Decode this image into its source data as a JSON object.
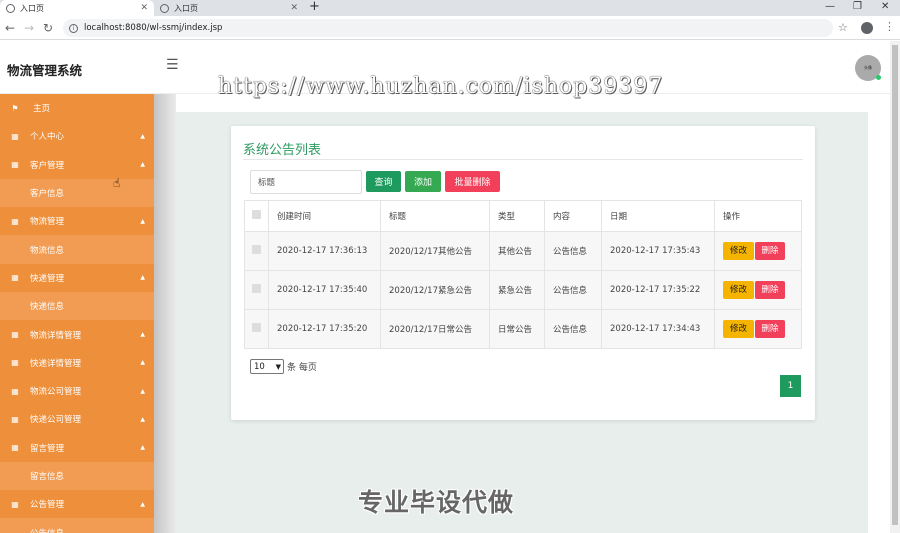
{
  "browser": {
    "tabs": [
      {
        "label": "入口页",
        "active": true
      },
      {
        "label": "入口页",
        "active": false
      }
    ],
    "url": "localhost:8080/wl-ssmj/index.jsp"
  },
  "header": {
    "brand": "物流管理系统",
    "avatar_text": "头像",
    "watermark": "https://www.huzhan.com/ishop39397"
  },
  "sidebar": {
    "items": [
      {
        "label": "主页",
        "type": "group",
        "icon": "flag-icon"
      },
      {
        "label": "个人中心",
        "type": "group",
        "icon": "grid-icon",
        "arrow": true
      },
      {
        "label": "客户管理",
        "type": "group",
        "icon": "grid-icon",
        "arrow": true
      },
      {
        "label": "客户信息",
        "type": "sub"
      },
      {
        "label": "物流管理",
        "type": "group",
        "icon": "grid-icon",
        "arrow": true
      },
      {
        "label": "物流信息",
        "type": "sub"
      },
      {
        "label": "快递管理",
        "type": "group",
        "icon": "grid-icon",
        "arrow": true
      },
      {
        "label": "快递信息",
        "type": "sub"
      },
      {
        "label": "物流详情管理",
        "type": "group",
        "icon": "grid-icon",
        "arrow": true
      },
      {
        "label": "快递详情管理",
        "type": "group",
        "icon": "grid-icon",
        "arrow": true
      },
      {
        "label": "物流公司管理",
        "type": "group",
        "icon": "grid-icon",
        "arrow": true
      },
      {
        "label": "快递公司管理",
        "type": "group",
        "icon": "grid-icon",
        "arrow": true
      },
      {
        "label": "留言管理",
        "type": "group",
        "icon": "grid-icon",
        "arrow": true
      },
      {
        "label": "留言信息",
        "type": "sub"
      },
      {
        "label": "公告管理",
        "type": "group",
        "icon": "grid-icon",
        "arrow": true
      },
      {
        "label": "公告信息",
        "type": "sub"
      }
    ]
  },
  "main": {
    "title": "系统公告列表",
    "search_placeholder": "标题",
    "buttons": {
      "query": "查询",
      "add": "添加",
      "batch_delete": "批量删除"
    },
    "columns": [
      "创建时间",
      "标题",
      "类型",
      "内容",
      "日期",
      "操作"
    ],
    "rows": [
      {
        "created": "2020-12-17 17:36:13",
        "title": "2020/12/17其他公告",
        "type": "其他公告",
        "content": "公告信息",
        "date": "2020-12-17 17:35:43"
      },
      {
        "created": "2020-12-17 17:35:40",
        "title": "2020/12/17紧急公告",
        "type": "紧急公告",
        "content": "公告信息",
        "date": "2020-12-17 17:35:22"
      },
      {
        "created": "2020-12-17 17:35:20",
        "title": "2020/12/17日常公告",
        "type": "日常公告",
        "content": "公告信息",
        "date": "2020-12-17 17:34:43"
      }
    ],
    "edit_label": "修改",
    "delete_label": "删除",
    "page_size": "10",
    "page_size_suffix": "条 每页",
    "current_page": "1"
  },
  "overlay_text": "专业毕设代做"
}
